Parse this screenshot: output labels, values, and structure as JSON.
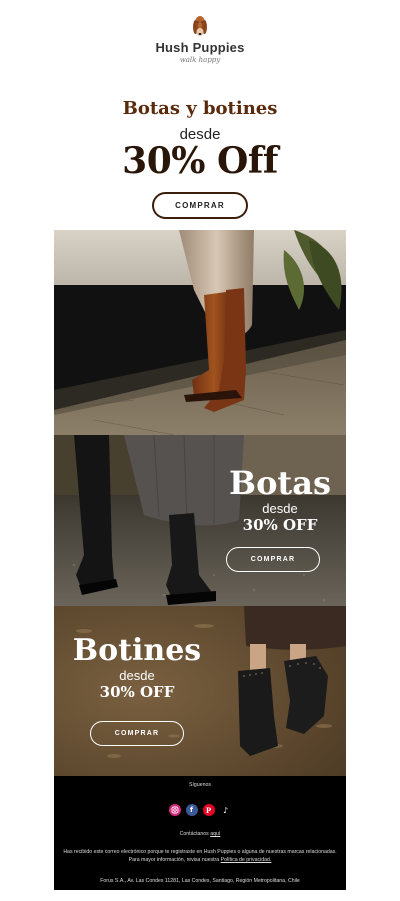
{
  "header": {
    "brand": "Hush Puppies",
    "tagline": "walk happy"
  },
  "hero": {
    "title": "Botas y botines",
    "desde": "desde",
    "offer": "30% Off",
    "button": "COMPRAR"
  },
  "botas": {
    "title": "Botas",
    "desde": "desde",
    "offer": "30% OFF",
    "button": "COMPRAR"
  },
  "botines": {
    "title": "Botines",
    "desde": "desde",
    "offer": "30% OFF",
    "button": "COMPRAR"
  },
  "footer": {
    "follow": "Síguenos",
    "socials": [
      "instagram-icon",
      "facebook-icon",
      "pinterest-icon",
      "tiktok-icon"
    ],
    "contact_prefix": "Contáctanos",
    "contact_link": "aquí",
    "legal1": "Has recibido este correo electrónico porque te registraste en Hush Puppies o alguna de nuestras marcas relacionadas.",
    "legal2_prefix": "Para mayor información, revisa nuestra",
    "privacy_link": "Política de privacidad.",
    "address": "Forus S.A., Av. Las Condes 11281, Las Condes, Santiago, Región Metropolitana, Chile"
  },
  "colors": {
    "accent_brown": "#5a2a0c",
    "footer_bg": "#000000"
  }
}
